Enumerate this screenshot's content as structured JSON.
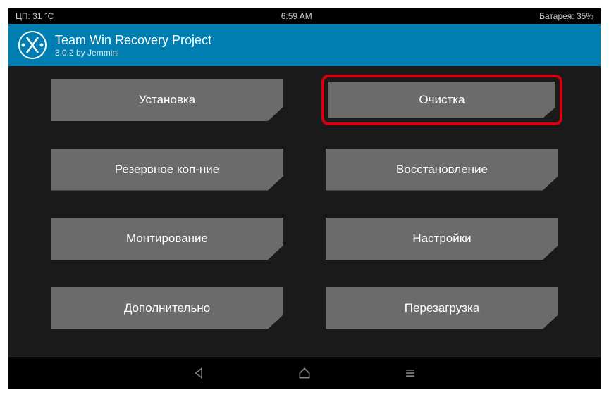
{
  "status": {
    "cpu_temp": "ЦП: 31 °C",
    "time": "6:59 AM",
    "battery": "Батарея: 35%"
  },
  "header": {
    "title": "Team Win Recovery Project",
    "subtitle": "3.0.2 by Jemmini"
  },
  "buttons": {
    "install": "Установка",
    "wipe": "Очистка",
    "backup": "Резервное коп-ние",
    "restore": "Восстановление",
    "mount": "Монтирование",
    "settings": "Настройки",
    "advanced": "Дополнительно",
    "reboot": "Перезагрузка"
  },
  "highlighted": "wipe"
}
